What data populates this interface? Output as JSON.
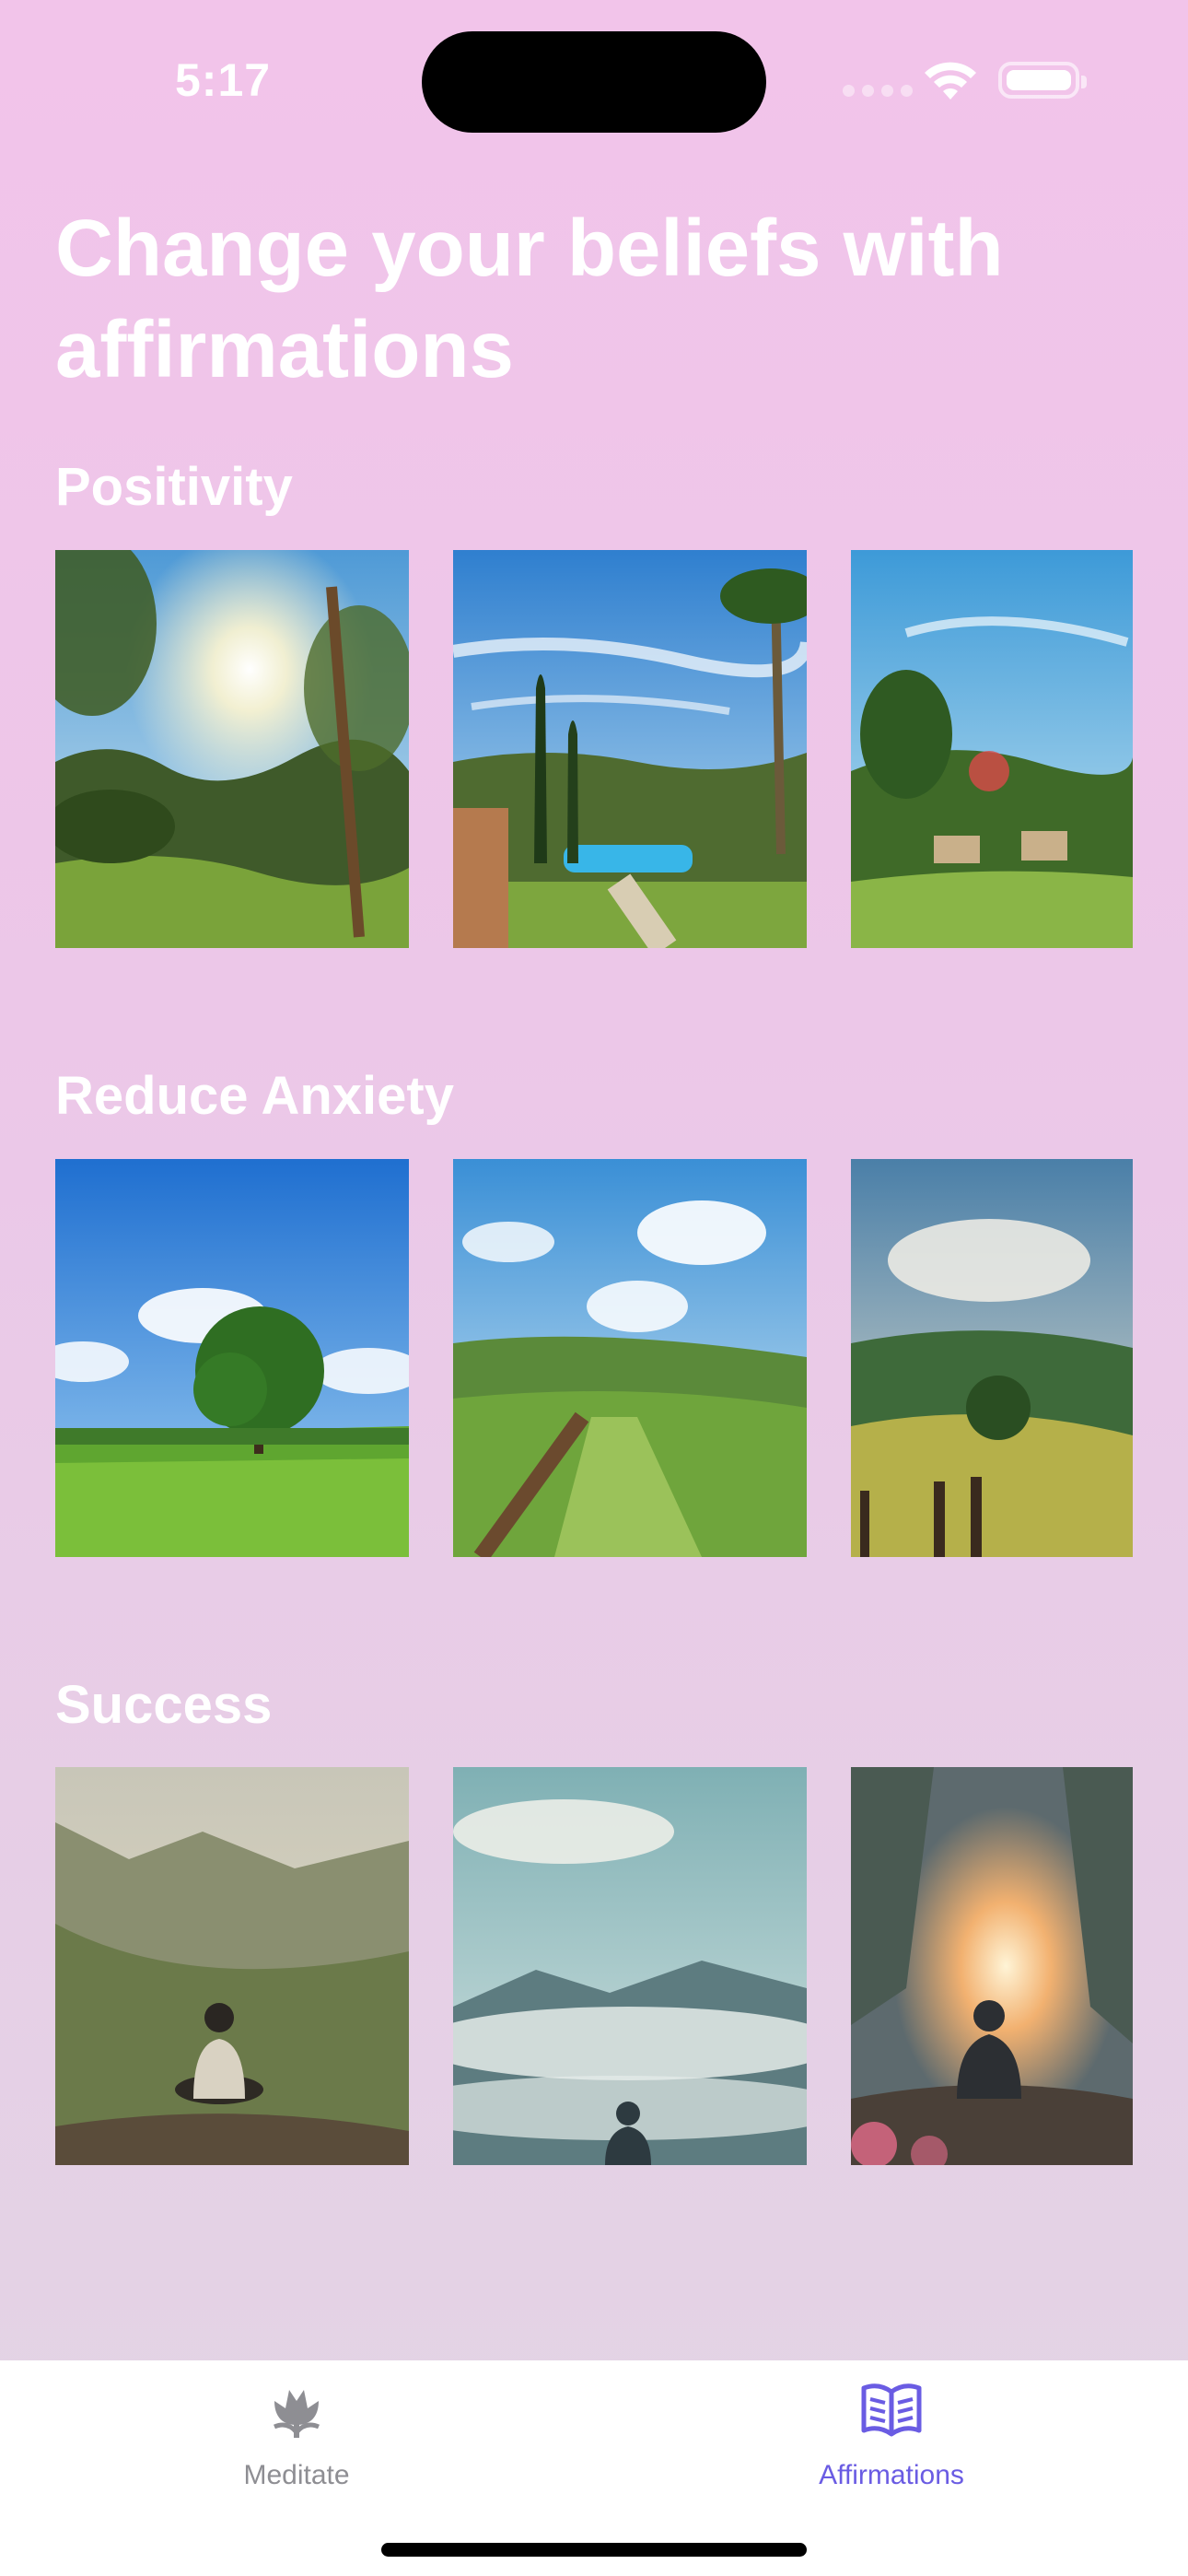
{
  "status": {
    "time": "5:17"
  },
  "page": {
    "title": "Change your beliefs with affirmations"
  },
  "sections": [
    {
      "title": "Positivity"
    },
    {
      "title": "Reduce Anxiety"
    },
    {
      "title": "Success"
    }
  ],
  "tabs": [
    {
      "label": "Meditate",
      "icon": "tulip-icon",
      "selected": false
    },
    {
      "label": "Affirmations",
      "icon": "open-book-icon",
      "selected": true
    }
  ],
  "colors": {
    "accent": "#6a5ce3",
    "inactive": "#8e8e93"
  }
}
